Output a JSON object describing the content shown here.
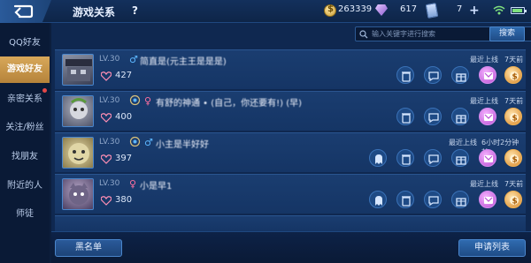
{
  "header": {
    "title": "游戏关系",
    "help": "?",
    "coins": "263339",
    "gems": "617",
    "tickets": "7"
  },
  "sidebar": {
    "items": [
      {
        "label": "QQ好友"
      },
      {
        "label": "游戏好友"
      },
      {
        "label": "亲密关系"
      },
      {
        "label": "关注/粉丝"
      },
      {
        "label": "找朋友"
      },
      {
        "label": "附近的人"
      },
      {
        "label": "师徒"
      }
    ],
    "active_index": 1
  },
  "search": {
    "placeholder": "输入关键字进行搜索",
    "button": "搜索"
  },
  "friends": [
    {
      "level": "LV.30",
      "gender": "male",
      "name": "简直是(元主王是是是)",
      "intimacy": "427",
      "recent_label": "最近上线",
      "recent_value": "7天前"
    },
    {
      "level": "LV.30",
      "gender": "female",
      "name": "有舒的神通 • (自己，你还要有!) (早)",
      "intimacy": "400",
      "recent_label": "最近上线",
      "recent_value": "7天前"
    },
    {
      "level": "LV.30",
      "gender": "male",
      "name": "小主是半好好",
      "intimacy": "397",
      "recent_label": "最近上线",
      "recent_value": "6小时2分钟前"
    },
    {
      "level": "LV.30",
      "gender": "female",
      "name": "小是早1",
      "intimacy": "380",
      "recent_label": "最近上线",
      "recent_value": "7天前"
    }
  ],
  "footer": {
    "blacklist": "黑名单",
    "apply_list": "申请列表"
  },
  "icons": [
    "back-icon",
    "coin-icon",
    "gem-icon",
    "ticket-icon",
    "plus-icon",
    "wifi-icon",
    "battery-icon",
    "search-icon",
    "heart-icon",
    "trash-icon",
    "chat-icon",
    "gift-icon",
    "message-icon",
    "dollar-icon",
    "ghost-icon"
  ],
  "colors": {
    "accent": "#d8a85a",
    "bg": "#0c1e3d",
    "male": "#5cb6ff",
    "female": "#ff6fa0"
  }
}
